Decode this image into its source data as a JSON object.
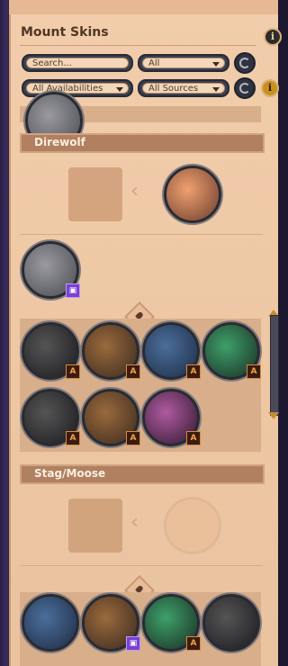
{
  "panel": {
    "title": "Mount Skins"
  },
  "filters": {
    "search_placeholder": "Search...",
    "type_value": "All",
    "availability_value": "All Availabilities",
    "sources_value": "All Sources"
  },
  "sections": [
    {
      "label": "Direwolf"
    },
    {
      "label": "Stag/Moose"
    }
  ],
  "icons": {
    "info": "info-icon",
    "reset": "reset-icon",
    "chevron": "chevron-left-icon",
    "lock": "lock-icon",
    "ascension": "A",
    "twitch": "twitch-icon"
  },
  "colors": {
    "panel_bg": "#f1c9a4",
    "section_band": "#b08061",
    "field_bg": "#f4d7b8",
    "ascension_badge": "#f2a24a",
    "twitch_badge": "#7a3fd6"
  }
}
